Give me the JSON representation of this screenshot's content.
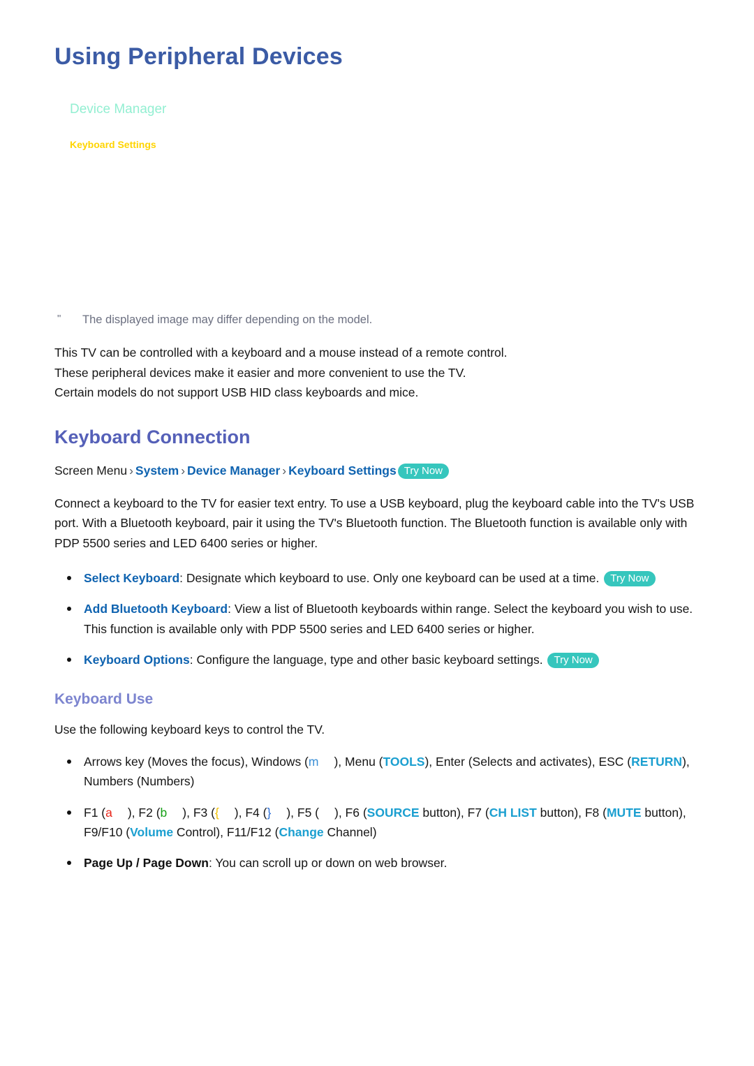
{
  "page": {
    "title": "Using Peripheral Devices"
  },
  "menu_figure": {
    "menu_title": "Device Manager",
    "menu_item": "Keyboard Settings"
  },
  "note": {
    "marker": "\"",
    "text": "The displayed image may differ depending on the model."
  },
  "intro": {
    "line1": "This TV can be controlled with a keyboard and a mouse instead of a remote control.",
    "line2": "These peripheral devices make it easier and more convenient to use the TV.",
    "line3": "Certain models do not support USB HID class keyboards and mice."
  },
  "keyboard_connection": {
    "heading": "Keyboard Connection",
    "breadcrumb": {
      "root": "Screen Menu",
      "sep": "›",
      "link1": "System",
      "link2": "Device Manager",
      "link3": "Keyboard Settings",
      "try_now": "Try Now"
    },
    "body": "Connect a keyboard to the TV for easier text entry. To use a USB keyboard, plug the keyboard cable into the TV's USB port. With a Bluetooth keyboard, pair it using the TV's Bluetooth function. The Bluetooth function is available only with PDP 5500 series and LED 6400 series or higher.",
    "bullets": [
      {
        "term": "Select Keyboard",
        "colon": ":",
        "text": "Designate which keyboard to use. Only one keyboard can be used at a time.",
        "try_now": "Try Now"
      },
      {
        "term": "Add Bluetooth Keyboard",
        "colon": ":",
        "text": "View a list of Bluetooth keyboards within range. Select the keyboard you wish to use. This function is available only with PDP 5500 series and LED 6400 series or higher.",
        "try_now": ""
      },
      {
        "term": "Keyboard Options",
        "colon": ":",
        "text": "Configure the language, type and other basic keyboard settings.",
        "try_now": "Try Now"
      }
    ]
  },
  "keyboard_use": {
    "heading": "Keyboard Use",
    "intro": "Use the following keyboard keys to control the TV.",
    "arrows_bullet": {
      "t1": "Arrows key (Moves the focus), Windows (",
      "key_m": "m",
      "t2": "), Menu (",
      "key_tools": "TOOLS",
      "t3": "), Enter (Selects and activates), ESC (",
      "key_return": "RETURN",
      "t4": "), Numbers (Numbers)"
    },
    "fkeys_bullet": {
      "t1": "F1 (",
      "key_a": "a",
      "t2": "), F2 (",
      "key_b": "b",
      "t3": "), F3 (",
      "key_brace_open": "{",
      "t4": "), F4 (",
      "key_brace_close": "}",
      "t5": "), F5 (",
      "key_blank": "",
      "t6": "), F6 (",
      "key_source": "SOURCE",
      "t7": " button), F7 (",
      "key_chlist": "CH LIST",
      "t8": " button), F8 (",
      "key_mute": "MUTE",
      "t9": " button), F9/F10 (",
      "key_volume": "Volume",
      "t10": " Control), F11/F12 (",
      "key_change": "Change",
      "t11": " Channel)"
    },
    "page_bullet": {
      "term": "Page Up / Page Down",
      "colon": ":",
      "text": "You can scroll up or down on web browser."
    }
  },
  "colors": {
    "title": "#3b5ba5",
    "h2": "#5560b8",
    "h3": "#7c84cf",
    "link_blue": "#0f63b0",
    "try_now_bg": "#36c6bd",
    "menu_title": "#93efd2",
    "menu_item": "#ffd400",
    "note_gray": "#6b6f80",
    "key_teal": "#1b9fd0",
    "key_red": "#e8261a",
    "key_green": "#17a017",
    "key_yellow": "#f0c000",
    "key_blue": "#2b6fd8"
  }
}
